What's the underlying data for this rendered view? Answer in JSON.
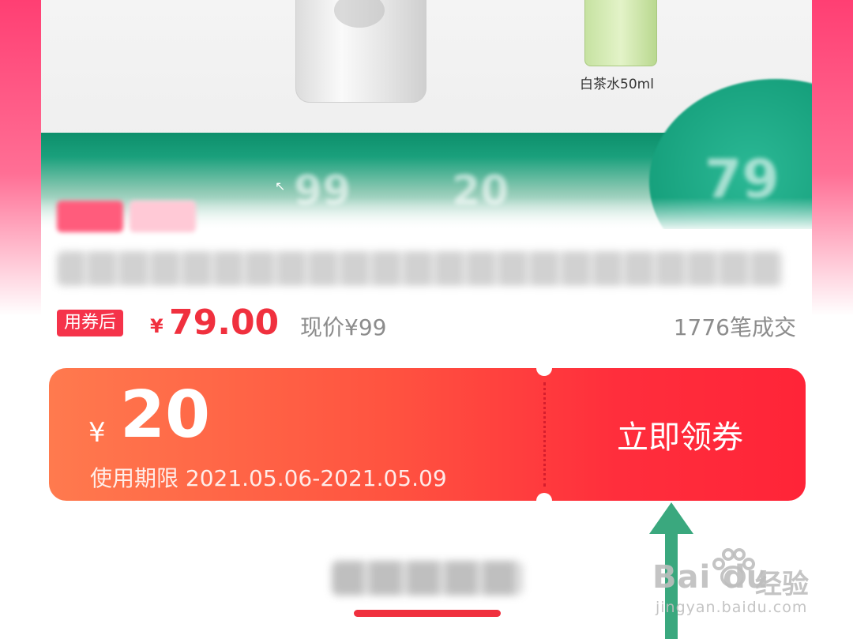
{
  "product": {
    "image_caption": "白茶水50ml"
  },
  "price": {
    "after_coupon_label": "用券后",
    "currency_symbol": "¥",
    "value": "79.00",
    "current_price": "现价¥99",
    "sales": "1776笔成交"
  },
  "coupon": {
    "currency_symbol": "¥",
    "amount": "20",
    "validity": "使用期限 2021.05.06-2021.05.09",
    "claim_label": "立即领券"
  },
  "watermark": {
    "logo": "Bai  du",
    "name": "经验",
    "url": "jingyan.baidu.com"
  },
  "colors": {
    "accent_red": "#f0303e",
    "coupon_start": "#ff7a4e",
    "coupon_end": "#ff2438",
    "arrow_green": "#3aa87e",
    "brand_pink": "#ff3f73"
  },
  "icons": [
    "arrow-up-icon",
    "baidu-paw-icon"
  ]
}
